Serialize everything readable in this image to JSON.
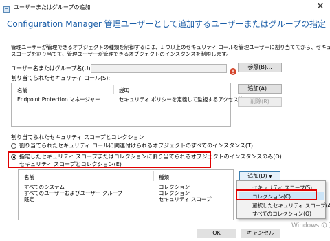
{
  "window": {
    "title": "ユーザーまたはグループの追加",
    "close_glyph": "✕"
  },
  "header": {
    "title": "Configuration Manager 管理ユーザーとして追加するユーザーまたはグループの指定"
  },
  "description": {
    "line1": "管理ユーザーが管理できるオブジェクトの種類を制御するには、1 つ以上のセキュリティ ロールを管理ユーザーに割り当ててから、セキュリティ",
    "line2": "スコープを割り当てて、管理ユーザーが管理できるオブジェクトのインスタンスを制限します。"
  },
  "user_group": {
    "label": "ユーザー名またはグループ名(U):",
    "value": "",
    "browse_label": "参照(B)..."
  },
  "roles": {
    "label": "割り当てられたセキュリティ ロール(S):",
    "columns": [
      "名前",
      "説明"
    ],
    "rows": [
      {
        "name": "Endpoint Protection マネージャー",
        "description": "セキュリティ ポリシーを定義して監視するアクセス許..."
      }
    ],
    "add_label": "追加(A)...",
    "remove_label": "削除(R)"
  },
  "scopes": {
    "label": "割り当てられたセキュリティ スコープとコレクション",
    "option_all": "割り当てられたセキュリティ ロールに関連付けられるオブジェクトのすべてのインスタンス(T)",
    "option_only": "指定したセキュリティ スコープまたはコレクションに割り当てられるオブジェクトのインスタンスのみ(O)",
    "sub_label": "セキュリティ スコープとコレクション(E)",
    "columns": [
      "名前",
      "種類"
    ],
    "rows": [
      {
        "name": "すべてのシステム",
        "type": "コレクション"
      },
      {
        "name": "すべてのユーザーおよびユーザー グループ",
        "type": "コレクション"
      },
      {
        "name": "既定",
        "type": "セキュリティ スコープ"
      }
    ],
    "add_label": "追加(D)",
    "add_arrow": "▼"
  },
  "dropdown_menu": {
    "items": [
      "セキュリティ スコープ(S)",
      "コレクション(C)",
      "選択したセキュリティ スコープ(A)",
      "すべてのコレクション(O)"
    ],
    "highlighted_index": 1
  },
  "footer": {
    "ok_label": "OK",
    "cancel_label": "キャンセル"
  },
  "watermark": {
    "text": "Windows のライセ"
  },
  "colors": {
    "accent": "#1b5ea8",
    "highlight": "#e00000",
    "menu_hover": "#cce4f7",
    "warning": "#d4442a"
  }
}
